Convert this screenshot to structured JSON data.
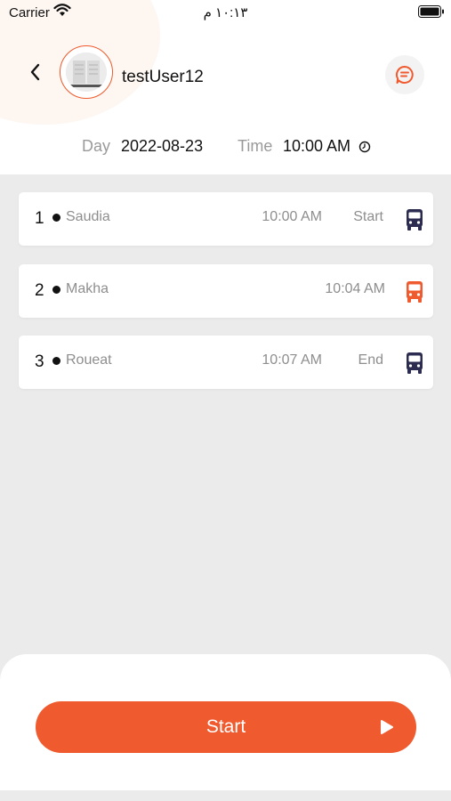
{
  "status_bar": {
    "carrier": "Carrier",
    "time": "١٠:١٣ م"
  },
  "header": {
    "username": "testUser12"
  },
  "schedule": {
    "day_label": "Day",
    "day_value": "2022-08-23",
    "time_label": "Time",
    "time_value": "10:00 AM"
  },
  "stops": [
    {
      "index": "1",
      "name": "Saudia",
      "time": "10:00 AM",
      "tag": "Start",
      "bus_color": "#2b2c50"
    },
    {
      "index": "2",
      "name": "Makha",
      "time": "10:04 AM",
      "tag": "",
      "bus_color": "#f05a2f"
    },
    {
      "index": "3",
      "name": "Roueat",
      "time": "10:07 AM",
      "tag": "End",
      "bus_color": "#2b2c50"
    }
  ],
  "actions": {
    "start_label": "Start"
  },
  "colors": {
    "accent": "#f05a2f",
    "bus_default": "#2b2c50",
    "background": "#ebebeb"
  },
  "icons": [
    "wifi-icon",
    "battery-icon",
    "back-chevron-icon",
    "chat-icon",
    "clock-icon",
    "bus-icon",
    "play-icon"
  ]
}
